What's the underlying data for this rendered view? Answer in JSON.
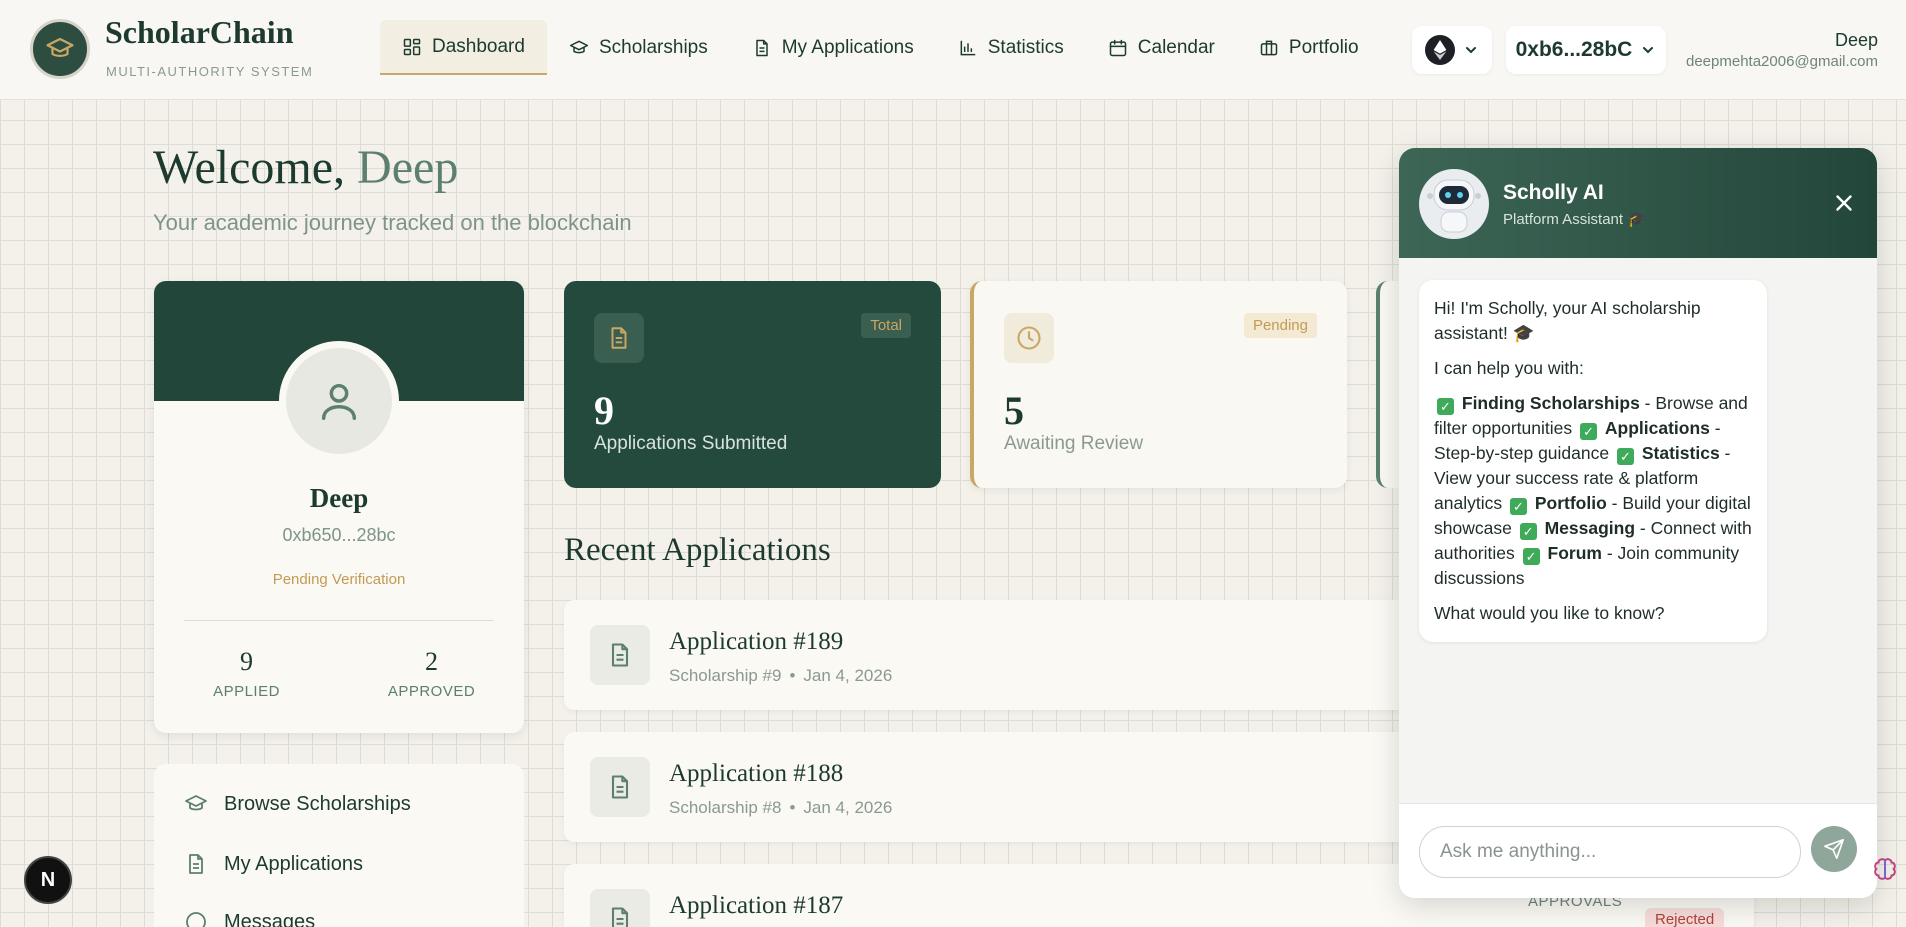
{
  "header": {
    "brand": "ScholarChain",
    "brand_sub": "MULTI-AUTHORITY SYSTEM",
    "nav": [
      {
        "label": "Dashboard",
        "icon": "grid-icon",
        "active": true
      },
      {
        "label": "Scholarships",
        "icon": "graduation-cap-icon"
      },
      {
        "label": "My Applications",
        "icon": "document-icon"
      },
      {
        "label": "Statistics",
        "icon": "bar-chart-icon"
      },
      {
        "label": "Calendar",
        "icon": "calendar-icon"
      },
      {
        "label": "Portfolio",
        "icon": "briefcase-icon"
      }
    ],
    "wallet": "0xb6...28bC",
    "user_name": "Deep",
    "user_email": "deepmehta2006@gmail.com"
  },
  "welcome": {
    "prefix": "Welcome, ",
    "name": "Deep",
    "subtitle": "Your academic journey tracked on the blockchain"
  },
  "profile": {
    "name": "Deep",
    "address": "0xb650...28bc",
    "status": "Pending Verification",
    "applied_count": "9",
    "applied_label": "APPLIED",
    "approved_count": "2",
    "approved_label": "APPROVED"
  },
  "quick_links": [
    {
      "label": "Browse Scholarships",
      "icon": "graduation-cap-icon"
    },
    {
      "label": "My Applications",
      "icon": "document-icon"
    },
    {
      "label": "Messages",
      "icon": "chat-icon"
    }
  ],
  "stats": [
    {
      "badge": "Total",
      "value": "9",
      "label": "Applications Submitted",
      "icon": "document-icon"
    },
    {
      "badge": "Pending",
      "value": "5",
      "label": "Awaiting Review",
      "icon": "clock-icon"
    }
  ],
  "recent": {
    "title": "Recent Applications",
    "items": [
      {
        "title": "Application #189",
        "scholarship": "Scholarship #9",
        "date": "Jan 4, 2026"
      },
      {
        "title": "Application #188",
        "scholarship": "Scholarship #8",
        "date": "Jan 4, 2026"
      },
      {
        "title": "Application #187",
        "scholarship": "",
        "date": ""
      }
    ],
    "approvals_label": "APPROVALS",
    "rejected_label": "Rejected"
  },
  "chat": {
    "title": "Scholly AI",
    "subtitle": "Platform Assistant 🎓",
    "intro": "Hi! I'm Scholly, your AI scholarship assistant! 🎓",
    "help_intro": "I can help you with:",
    "features": [
      {
        "name": "Finding Scholarships",
        "desc": " - Browse and filter opportunities"
      },
      {
        "name": "Applications",
        "desc": " - Step-by-step guidance"
      },
      {
        "name": "Statistics",
        "desc": " - View your success rate & platform analytics"
      },
      {
        "name": "Portfolio",
        "desc": " - Build your digital showcase"
      },
      {
        "name": "Messaging",
        "desc": " - Connect with authorities"
      },
      {
        "name": "Forum",
        "desc": " - Join community discussions"
      }
    ],
    "question": "What would you like to know?",
    "placeholder": "Ask me anything..."
  },
  "colors": {
    "primary": "#23463a",
    "accent_gold": "#c9a765",
    "muted_green": "#5c7f6e",
    "background": "#f3f1ea",
    "rejected": "#b2413d"
  }
}
